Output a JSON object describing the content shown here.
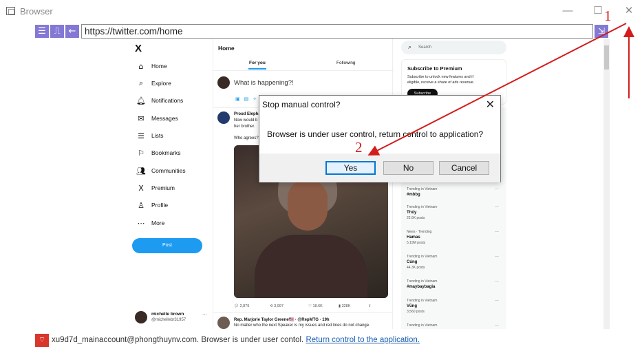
{
  "window": {
    "title": "Browser",
    "minimize": "—",
    "maximize": "☐",
    "close": "✕"
  },
  "toolbar": {
    "menu_icon": "☰",
    "route_icon": "⎍",
    "back_icon": "←",
    "url": "https://twitter.com/home",
    "right_icon": "⇲"
  },
  "twitter": {
    "logo": "X",
    "nav": [
      {
        "icon": "⌂",
        "label": "Home"
      },
      {
        "icon": "⌕",
        "label": "Explore"
      },
      {
        "icon": "🔔︎",
        "label": "Notifications"
      },
      {
        "icon": "✉",
        "label": "Messages"
      },
      {
        "icon": "☰",
        "label": "Lists"
      },
      {
        "icon": "⚐",
        "label": "Bookmarks"
      },
      {
        "icon": "👥︎",
        "label": "Communities"
      },
      {
        "icon": "X",
        "label": "Premium"
      },
      {
        "icon": "♙",
        "label": "Profile"
      },
      {
        "icon": "⋯",
        "label": "More"
      }
    ],
    "post_button": "Post",
    "account": {
      "name": "michelle brown",
      "handle": "@michellebr31957",
      "more": "···"
    },
    "home_title": "Home",
    "tabs": {
      "for_you": "For you",
      "following": "Following"
    },
    "compose_placeholder": "What is happening?!",
    "compose_icons": "▣▤✧☺",
    "post": {
      "author": "Proud Elephant",
      "lines": [
        "Now would b",
        "her brother.",
        "Who agrees?"
      ]
    },
    "stats": {
      "replies": "2,879",
      "retweets": "3,997",
      "likes": "18.6K",
      "views": "328K",
      "share": "⇪"
    },
    "reply": {
      "author": "Rep. Marjorie Taylor Greene🇺🇸 · @RepMTG · 19h",
      "text": "No matter who the next Speaker is my issues and red lines do not change."
    },
    "search_placeholder": "Search",
    "premium": {
      "title": "Subscribe to Premium",
      "desc1": "Subscribe to unlock new features and if",
      "desc2": "eligible, receive a share of ads revenue.",
      "button": "Subscribe"
    },
    "trends": [
      {
        "context": "Trending in Vietnam",
        "name": "#mbbg",
        "posts": ""
      },
      {
        "context": "Trending in Vietnam",
        "name": "Thủy",
        "posts": "22.6K posts"
      },
      {
        "context": "News · Trending",
        "name": "Hamas",
        "posts": "5.19M posts"
      },
      {
        "context": "Trending in Vietnam",
        "name": "Cúng",
        "posts": "44.3K posts"
      },
      {
        "context": "Trending in Vietnam",
        "name": "#maybaybagia",
        "posts": ""
      },
      {
        "context": "Trending in Vietnam",
        "name": "Vũng",
        "posts": "3,560 posts"
      },
      {
        "context": "Trending in Vietnam",
        "name": "",
        "posts": ""
      }
    ],
    "trend_more": "···"
  },
  "dialog": {
    "title": "Stop manual control?",
    "close": "✕",
    "message": "Browser is under user control, return control to application?",
    "yes": "Yes",
    "no": "No",
    "cancel": "Cancel"
  },
  "status": {
    "wifi_icon": "⌔",
    "text": "xu9d7d_mainaccount@phongthuynv.com. Browser is under user contol. ",
    "link": "Return control to the application."
  },
  "annotations": {
    "one": "1",
    "two": "2",
    "color": "#d41c1c"
  }
}
